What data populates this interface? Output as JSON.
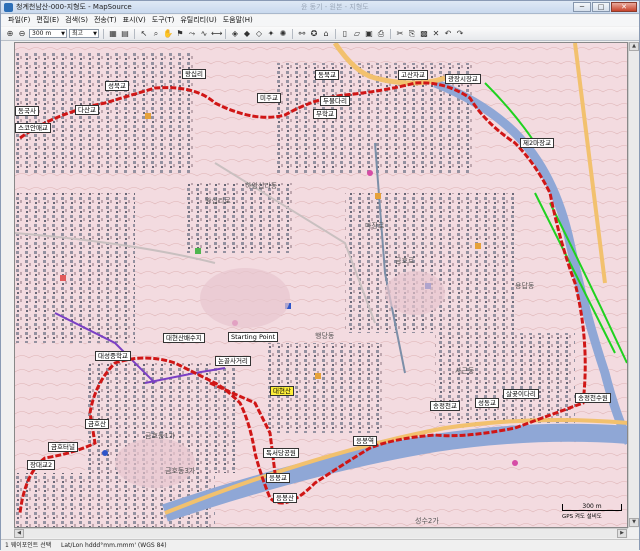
{
  "window": {
    "title": "청계천남산-000-지형도 - MapSource",
    "faded_title": "윤 동기 - 원본 - 지형도",
    "buttons": {
      "minimize": "─",
      "maximize": "□",
      "close": "✕"
    }
  },
  "menu": [
    "파일(F)",
    "편집(E)",
    "검색(S)",
    "전송(T)",
    "표시(V)",
    "도구(T)",
    "유틸리티(U)",
    "도움말(H)"
  ],
  "toolbar": {
    "zoom_value": "300 m",
    "detail_value": "최고"
  },
  "map": {
    "labels": [
      {
        "text": "동국사",
        "kind": "plain"
      },
      {
        "text": "성북교",
        "kind": "plain"
      },
      {
        "text": "왕십리",
        "kind": "plain"
      },
      {
        "text": "스코안매교",
        "kind": "plain"
      },
      {
        "text": "다산교",
        "kind": "plain"
      },
      {
        "text": "동북교",
        "kind": "plain"
      },
      {
        "text": "미주교",
        "kind": "plain"
      },
      {
        "text": "고산자교",
        "kind": "plain"
      },
      {
        "text": "광장시장교",
        "kind": "plain"
      },
      {
        "text": "무학교",
        "kind": "plain"
      },
      {
        "text": "두물다리",
        "kind": "plain"
      },
      {
        "text": "제2마장교",
        "kind": "plain"
      },
      {
        "text": "대현산배수지",
        "kind": "plain"
      },
      {
        "text": "Starting Point",
        "kind": "plain"
      },
      {
        "text": "대성중학교",
        "kind": "plain"
      },
      {
        "text": "논골사거리",
        "kind": "plain"
      },
      {
        "text": "대현산",
        "kind": "yellow"
      },
      {
        "text": "금호산",
        "kind": "plain"
      },
      {
        "text": "금호터널",
        "kind": "plain"
      },
      {
        "text": "장대교2",
        "kind": "plain"
      },
      {
        "text": "독서당공원",
        "kind": "plain"
      },
      {
        "text": "응봉역",
        "kind": "plain"
      },
      {
        "text": "응봉교",
        "kind": "plain"
      },
      {
        "text": "응봉산",
        "kind": "plain"
      },
      {
        "text": "성동교",
        "kind": "plain"
      },
      {
        "text": "살곶이다리",
        "kind": "plain"
      },
      {
        "text": "송정천교",
        "kind": "plain"
      },
      {
        "text": "송정천수원",
        "kind": "plain"
      }
    ],
    "area_texts": [
      "마장로",
      "왕십리로",
      "행당동",
      "금호동1가",
      "금호동3가",
      "성수2가",
      "하왕십리동",
      "사근동",
      "용답동",
      "금호로"
    ],
    "scale_label": "300 m",
    "gps_label": "GPS 켜도 설비도",
    "colors": {
      "background": "#f3dbe0",
      "route": "#d01616",
      "river": "#8fa7d6",
      "road_major": "#f2c16e",
      "park": "#1fd21f"
    }
  },
  "status": {
    "left": "1 웨이포인트 선택",
    "coord": "Lat/Lon hddd°mm.mmm' (WGS 84)"
  }
}
